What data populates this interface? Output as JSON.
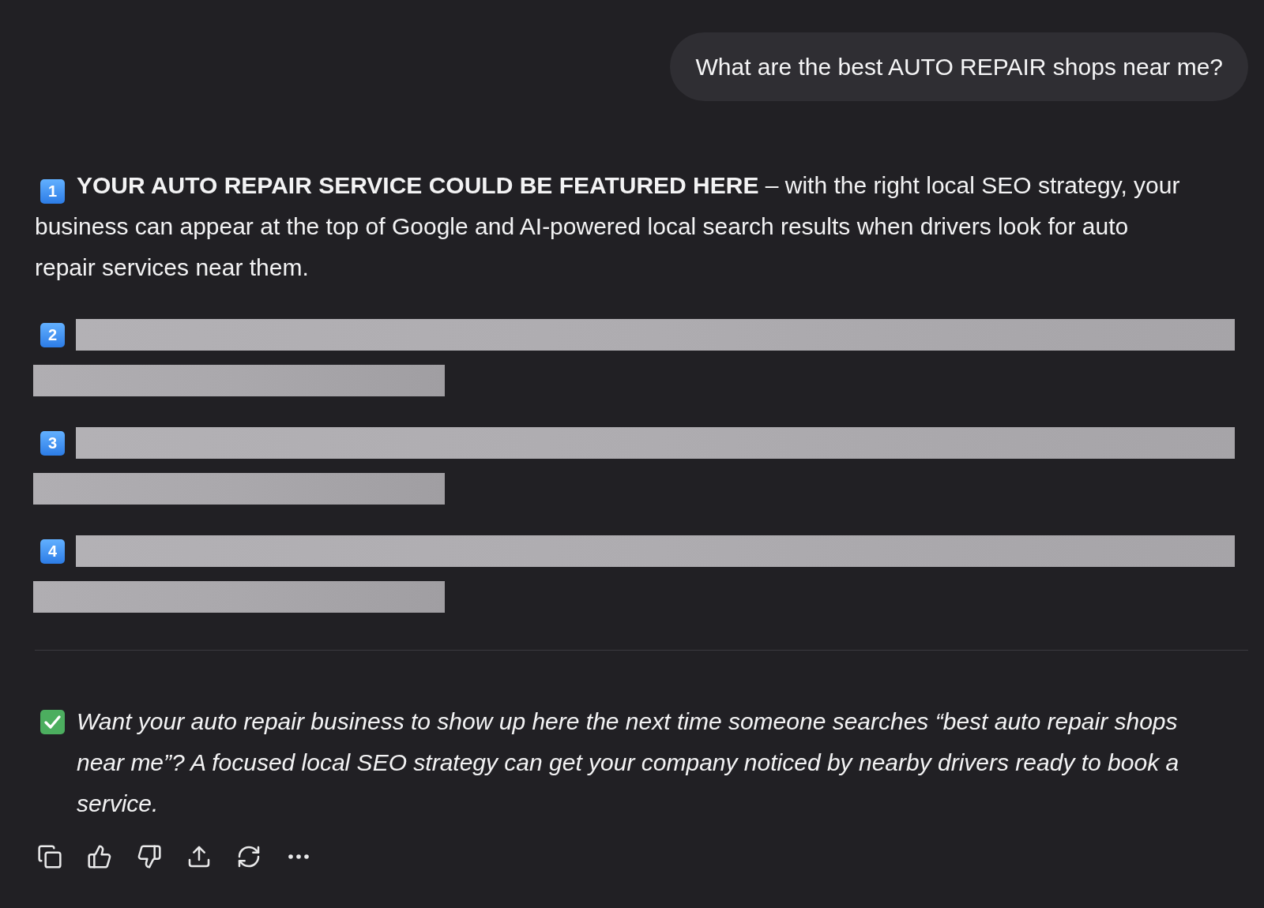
{
  "user_message": {
    "text": "What are the best AUTO REPAIR shops near me?"
  },
  "response": {
    "items": [
      {
        "kind": "featured",
        "marker": "1",
        "text": "**YOUR AUTO REPAIR SERVICE COULD BE FEATURED HERE** – with the right local SEO strategy, your business can appear at the top of Google and AI-powered local search results when drivers look for auto repair services near them."
      },
      {
        "kind": "redacted",
        "marker": "2"
      },
      {
        "kind": "redacted",
        "marker": "3"
      },
      {
        "kind": "redacted",
        "marker": "4"
      }
    ]
  },
  "closing": {
    "text": "Want your auto repair business to show up here the next time someone searches “best auto repair shops near me”? A focused local SEO strategy can get your company noticed by nearby drivers ready to book a service."
  }
}
